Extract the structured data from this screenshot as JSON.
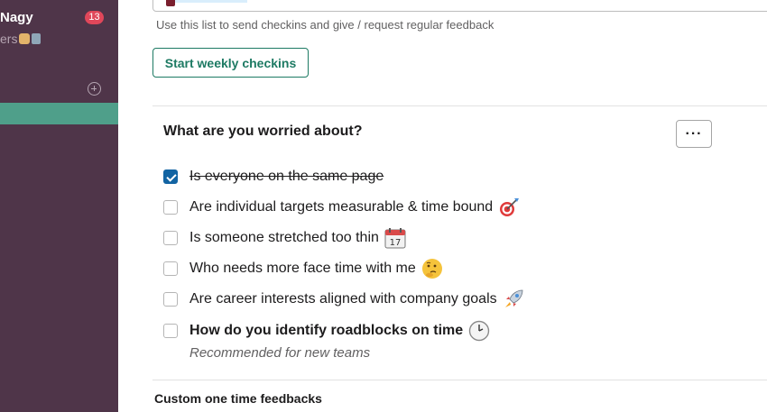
{
  "sidebar": {
    "user_name": "Nagy",
    "unread_badge": "13",
    "status_text": "ers"
  },
  "main": {
    "hint": "Use this list to send checkins and give / request regular feedback",
    "start_button": "Start weekly checkins",
    "section": {
      "title": "What are you worried about?",
      "more_label": "···",
      "items": [
        {
          "label": "Is everyone on the same page",
          "checked": true,
          "emoji": ""
        },
        {
          "label": "Are individual targets measurable & time bound",
          "checked": false,
          "emoji": "target-icon"
        },
        {
          "label": "Is someone stretched too thin",
          "checked": false,
          "emoji": "calendar-icon"
        },
        {
          "label": "Who needs more face time with me",
          "checked": false,
          "emoji": "thinking-face-icon"
        },
        {
          "label": "Are career interests aligned with company goals",
          "checked": false,
          "emoji": "rocket-icon"
        },
        {
          "label": "How do you identify roadblocks on time",
          "checked": false,
          "emoji": "clock-icon"
        }
      ],
      "recommended": "Recommended for new teams"
    },
    "custom_heading": "Custom one time feedbacks"
  },
  "colors": {
    "sidebar_bg": "#4f3549",
    "accent_green": "#1d7a63",
    "checkbox_blue": "#1264a3",
    "badge_red": "#e0475a"
  }
}
